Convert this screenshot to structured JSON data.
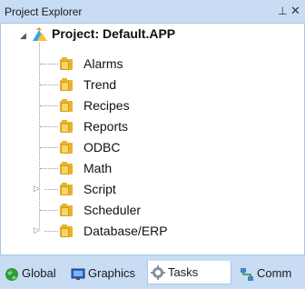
{
  "panel": {
    "title": "Project Explorer",
    "pin_glyph": "⊥",
    "close_glyph": "✕"
  },
  "tree": {
    "root": {
      "label": "Project: Default.APP",
      "icon": "project-icon"
    },
    "items": [
      {
        "label": "Alarms",
        "expandable": false
      },
      {
        "label": "Trend",
        "expandable": false
      },
      {
        "label": "Recipes",
        "expandable": false
      },
      {
        "label": "Reports",
        "expandable": false
      },
      {
        "label": "ODBC",
        "expandable": false
      },
      {
        "label": "Math",
        "expandable": false
      },
      {
        "label": "Script",
        "expandable": true
      },
      {
        "label": "Scheduler",
        "expandable": false
      },
      {
        "label": "Database/ERP",
        "expandable": true
      }
    ]
  },
  "tabs": [
    {
      "label": "Global",
      "icon": "globe-icon",
      "active": false
    },
    {
      "label": "Graphics",
      "icon": "monitor-icon",
      "active": false
    },
    {
      "label": "Tasks",
      "icon": "gear-icon",
      "active": true
    },
    {
      "label": "Comm",
      "icon": "network-icon",
      "active": false
    }
  ],
  "colors": {
    "accent": "#c8dcf3",
    "folder": "#e8b32b"
  }
}
